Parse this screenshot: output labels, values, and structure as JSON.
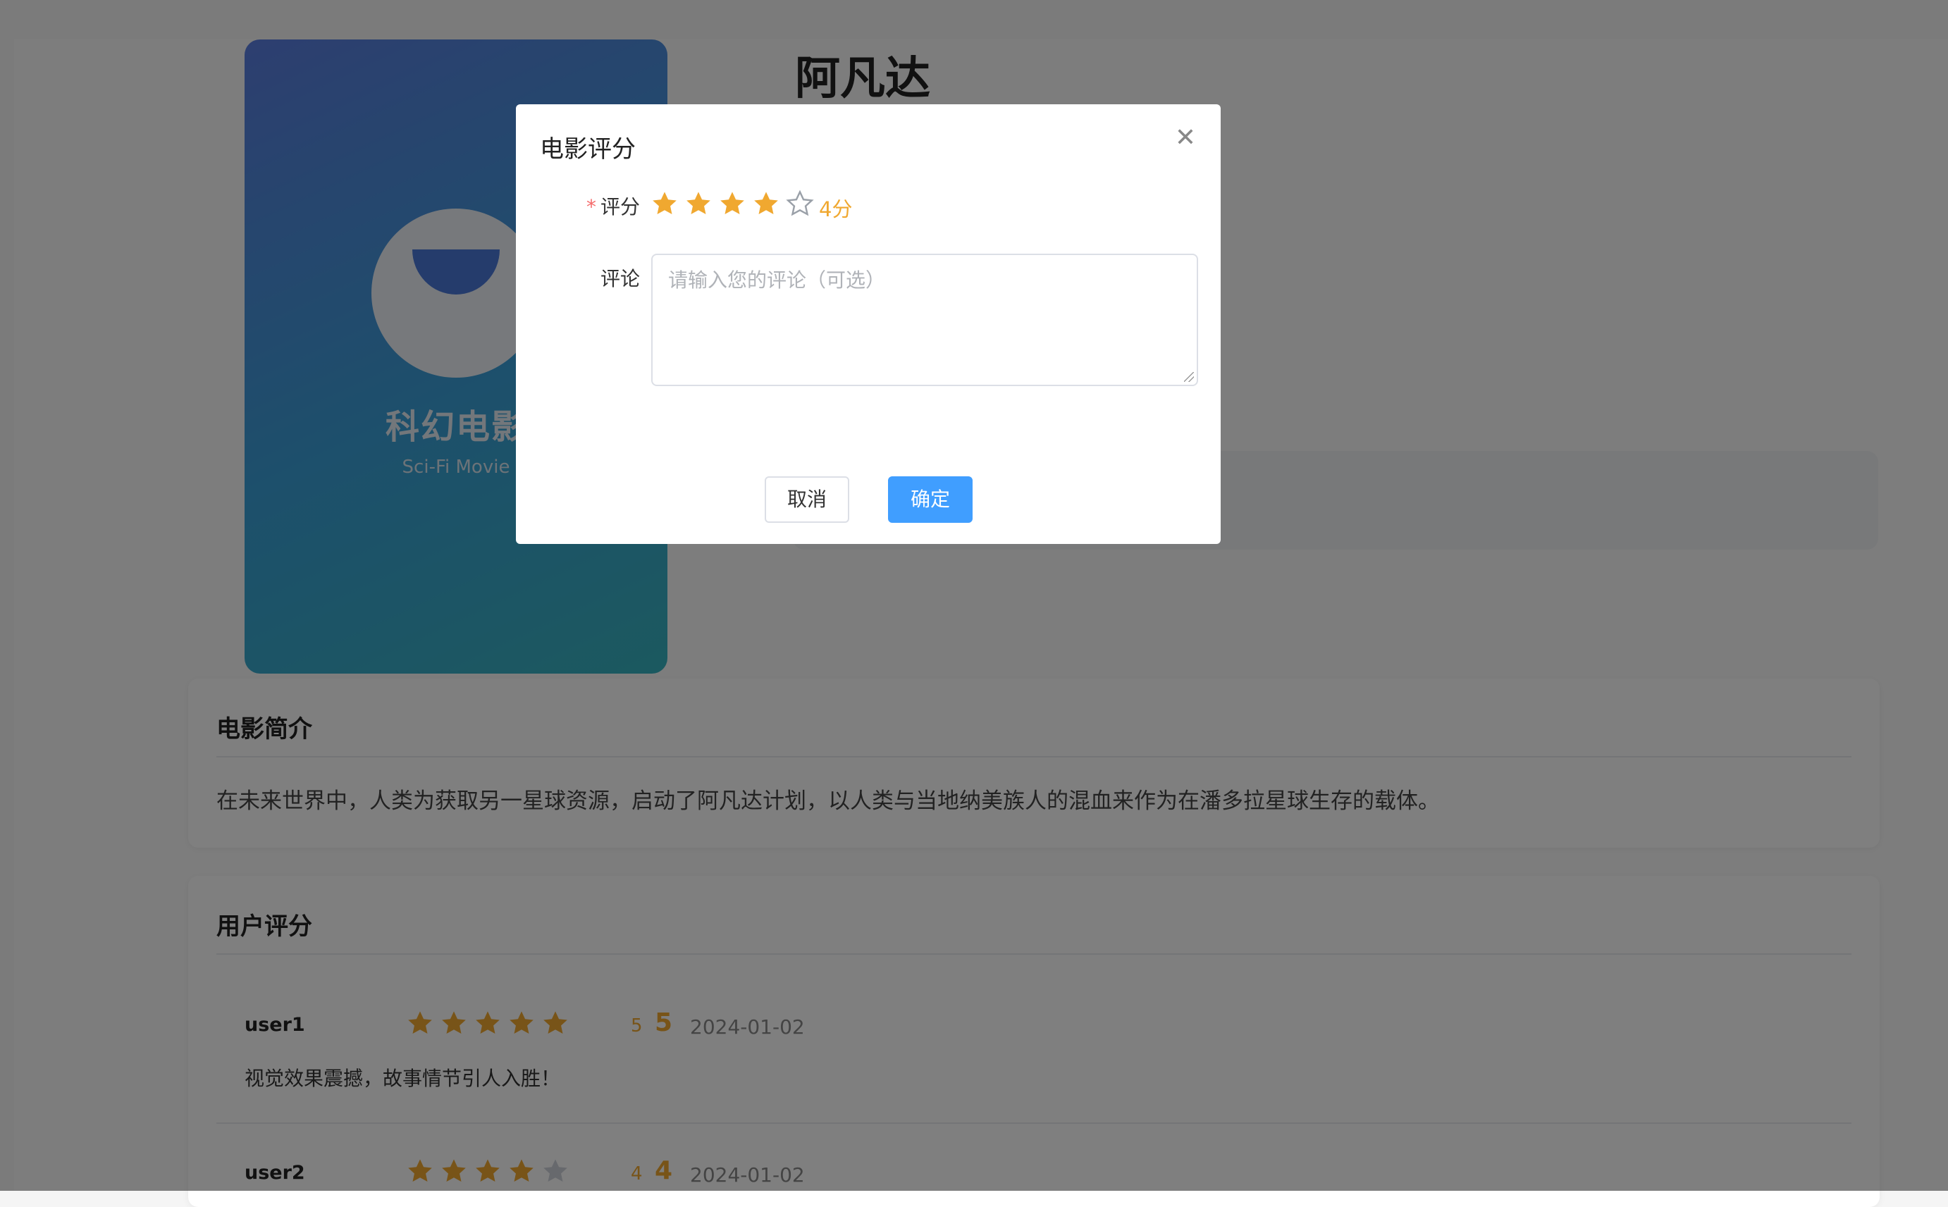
{
  "movie": {
    "title": "阿凡达",
    "poster": {
      "genre_title": "科幻电影",
      "genre_subtitle": "Sci-Fi Movie"
    }
  },
  "intro": {
    "heading": "电影简介",
    "text": "在未来世界中，人类为获取另一星球资源，启动了阿凡达计划，以人类与当地纳美族人的混血来作为在潘多拉星球生存的载体。"
  },
  "reviews": {
    "heading": "用户评分",
    "items": [
      {
        "user": "user1",
        "rating": 5,
        "rating_small": "5",
        "rating_big": "5",
        "date": "2024-01-02",
        "comment": "视觉效果震撼，故事情节引人入胜！"
      },
      {
        "user": "user2",
        "rating": 4,
        "rating_small": "4",
        "rating_big": "4",
        "date": "2024-01-02",
        "comment": ""
      }
    ]
  },
  "dialog": {
    "title": "电影评分",
    "close_icon": "close-icon",
    "rating_label": "评分",
    "required_mark": "*",
    "rating_value": 4,
    "rating_max": 5,
    "rating_text": "4分",
    "comment_label": "评论",
    "comment_placeholder": "请输入您的评论（可选）",
    "comment_value": "",
    "cancel_label": "取消",
    "confirm_label": "确定"
  },
  "colors": {
    "star_active": "#f0a830",
    "star_inactive": "#cfd3da",
    "primary": "#409eff",
    "required": "#f56c6c"
  }
}
